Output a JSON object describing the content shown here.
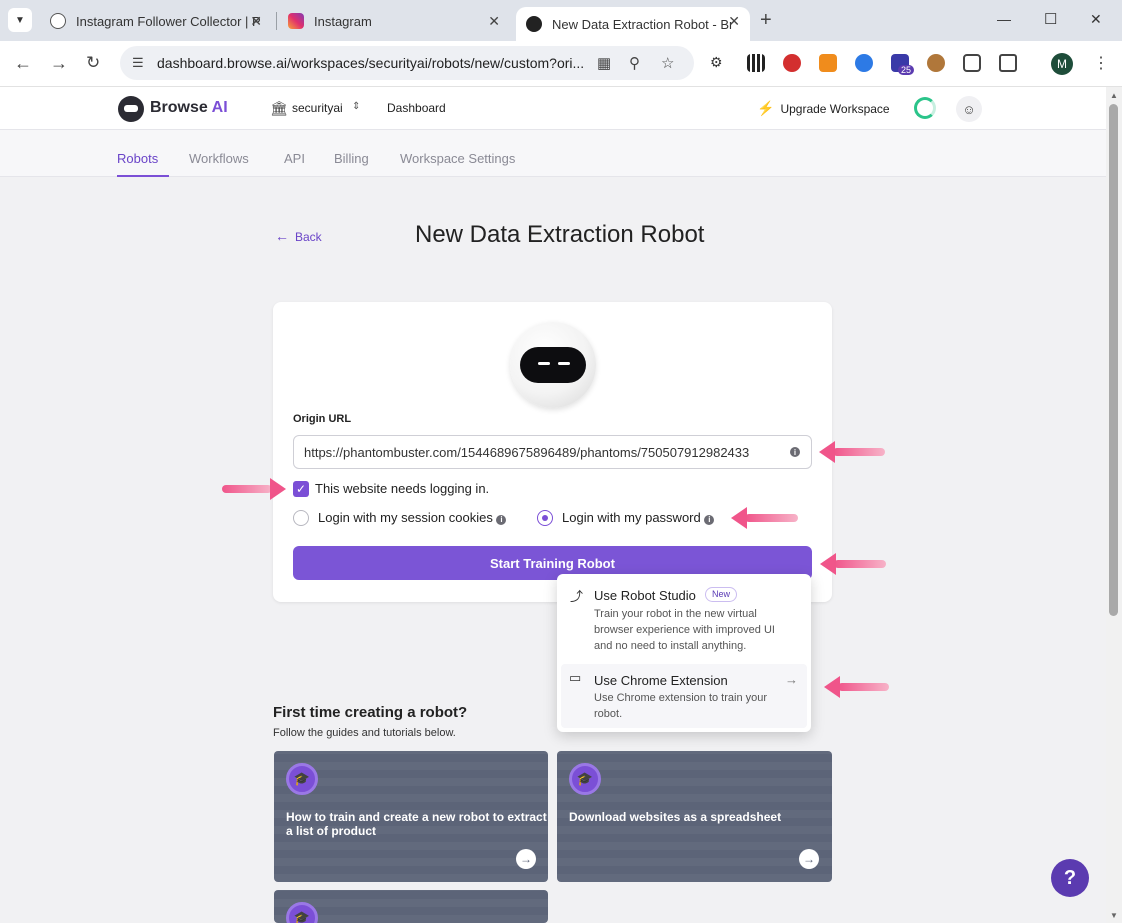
{
  "browser": {
    "tabs": [
      {
        "title": "Instagram Follower Collector | P",
        "icon": "ghost-icon"
      },
      {
        "title": "Instagram",
        "icon": "instagram-icon"
      },
      {
        "title": "New Data Extraction Robot - Br",
        "icon": "robot-icon"
      }
    ],
    "url": "dashboard.browse.ai/workspaces/securityai/robots/new/custom?ori...",
    "profile_initial": "M",
    "extension_badge": "25"
  },
  "header": {
    "logo_text": "Browse",
    "logo_ai": "AI",
    "workspace": "securityai",
    "dashboard_link": "Dashboard",
    "upgrade_label": "Upgrade Workspace"
  },
  "subnav": {
    "items": [
      "Robots",
      "Workflows",
      "API",
      "Billing",
      "Workspace Settings"
    ],
    "active": "Robots"
  },
  "page": {
    "back_label": "Back",
    "title": "New Data Extraction Robot"
  },
  "form": {
    "origin_label": "Origin URL",
    "origin_value": "https://phantombuster.com/1544689675896489/phantoms/750507912982433",
    "login_checkbox_label": "This website needs logging in.",
    "login_checked": true,
    "option_cookies": "Login with my session cookies",
    "option_password": "Login with my password",
    "selected_option": "password",
    "start_button": "Start Training Robot"
  },
  "dropdown": {
    "studio_title": "Use Robot Studio",
    "studio_badge": "New",
    "studio_desc_1": "Train your robot in the new virtual",
    "studio_desc_2": "browser experience with improved UI",
    "studio_desc_3": "and no need to install anything.",
    "extension_title": "Use Chrome Extension",
    "extension_desc_1": "Use Chrome extension to train your",
    "extension_desc_2": "robot."
  },
  "guides": {
    "title": "First time creating a robot?",
    "subtitle": "Follow the guides and tutorials below.",
    "cards": [
      {
        "line1": "How to train and create a new robot to extract",
        "line2": "a list of product"
      },
      {
        "line1": "Download websites as a spreadsheet",
        "line2": ""
      }
    ]
  },
  "help_label": "?",
  "colors": {
    "accent": "#7b4fd6",
    "annotation_arrow": "#f0558a"
  }
}
